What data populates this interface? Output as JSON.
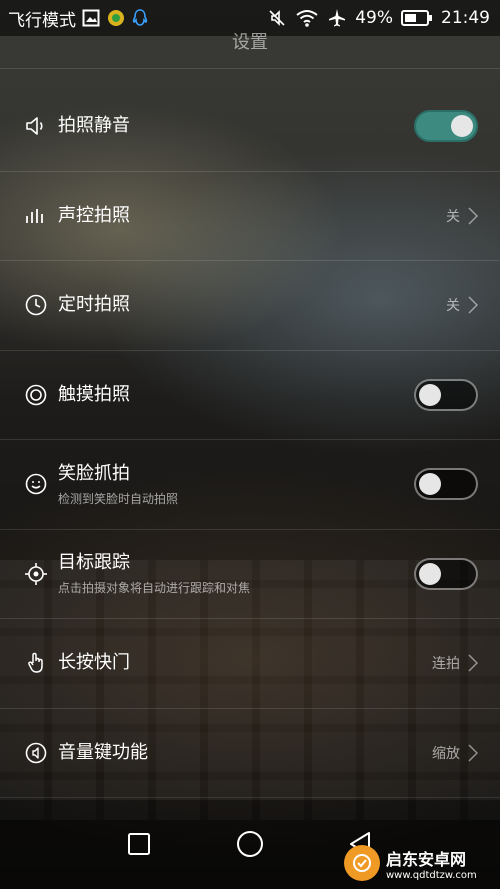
{
  "status_bar": {
    "left_text": "飞行模式",
    "battery": "49%",
    "time": "21:49"
  },
  "header": {
    "title": "设置"
  },
  "settings": [
    {
      "label": "拍照静音",
      "subtitle": "",
      "control": "toggle",
      "state": "on",
      "icon": "speaker-icon"
    },
    {
      "label": "声控拍照",
      "subtitle": "",
      "control": "value",
      "value": "关",
      "icon": "voice-bars-icon"
    },
    {
      "label": "定时拍照",
      "subtitle": "",
      "control": "value",
      "value": "关",
      "icon": "clock-icon"
    },
    {
      "label": "触摸拍照",
      "subtitle": "",
      "control": "toggle",
      "state": "off",
      "icon": "touch-target-icon"
    },
    {
      "label": "笑脸抓拍",
      "subtitle": "检测到笑脸时自动拍照",
      "control": "toggle",
      "state": "off",
      "icon": "smile-icon"
    },
    {
      "label": "目标跟踪",
      "subtitle": "点击拍摄对象将自动进行跟踪和对焦",
      "control": "toggle",
      "state": "off",
      "icon": "crosshair-icon"
    },
    {
      "label": "长按快门",
      "subtitle": "",
      "control": "value",
      "value": "连拍",
      "icon": "hand-press-icon"
    },
    {
      "label": "音量键功能",
      "subtitle": "",
      "control": "value",
      "value": "缩放",
      "icon": "volume-key-icon"
    }
  ],
  "nav_bar": {
    "buttons": [
      "recent-apps",
      "home",
      "back"
    ]
  },
  "watermark": {
    "name": "启东安卓网",
    "url": "www.qdtdtzw.com"
  },
  "colors": {
    "toggle_on": "#3d8a80",
    "status_bar_bg": "#000000"
  }
}
